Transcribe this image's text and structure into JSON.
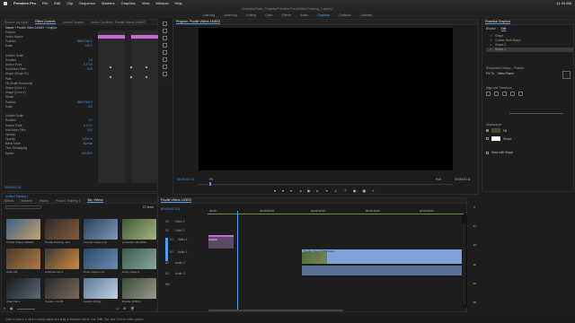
{
  "menubar": {
    "app": "Premiere Pro",
    "items": [
      "File",
      "Edit",
      "Clip",
      "Sequence",
      "Markers",
      "Graphics",
      "View",
      "Window",
      "Help"
    ],
    "clock": "11:34 AM"
  },
  "window_title": "/Volumes/Data/_Projects/Premiere Pro/Untitled Training_1.prproj *",
  "workspaces": {
    "items": [
      "Learning",
      "Assembly",
      "Editing",
      "Color",
      "Effects",
      "Audio",
      "Graphics",
      "Captions",
      "Libraries"
    ],
    "active_index": 6
  },
  "effect_controls": {
    "tabs": [
      "Source: (no clips)",
      "Effect Controls",
      "Lumetri Scopes",
      "Audio Clip Mixer: Poodle Videos 140823"
    ],
    "active_tab": 1,
    "header_clip": "Master * Poodle Video 140823 * Graphic",
    "rows": [
      {
        "label": "Graphic",
        "value": ""
      },
      {
        "label": "Vector Motion",
        "value": ""
      },
      {
        "label": "Position",
        "value": "960.0  540.0"
      },
      {
        "label": "Scale",
        "value": "100.0"
      },
      {
        "label": "",
        "value": ""
      },
      {
        "label": "Uniform Scale",
        "value": ""
      },
      {
        "label": "Rotation",
        "value": "0.0"
      },
      {
        "label": "Anchor Point",
        "value": "0.0  0.0"
      },
      {
        "label": "Anti-flicker Filter",
        "value": "0.00"
      },
      {
        "label": "Shape (Shape 01)",
        "value": ""
      },
      {
        "label": "Path",
        "value": ""
      },
      {
        "label": "Fill (Scale Horizontal)",
        "value": ""
      },
      {
        "label": "Shape (Color 1)",
        "value": ""
      },
      {
        "label": "Shape (Color 2)",
        "value": ""
      },
      {
        "label": "Stroke",
        "value": ""
      },
      {
        "label": "Position",
        "value": "960.0  540.0"
      },
      {
        "label": "Scale",
        "value": "100"
      },
      {
        "label": "",
        "value": ""
      },
      {
        "label": "Uniform Scale",
        "value": ""
      },
      {
        "label": "Rotation",
        "value": "0.0"
      },
      {
        "label": "Anchor Point",
        "value": "0.0  0.0"
      },
      {
        "label": "Anti-flicker Filter",
        "value": "0.00"
      },
      {
        "label": "Opacity",
        "value": ""
      },
      {
        "label": "Opacity",
        "value": "100.0 %"
      },
      {
        "label": "Blend Mode",
        "value": "Normal"
      },
      {
        "label": "Time Remapping",
        "value": ""
      },
      {
        "label": "Speed",
        "value": "100.00%"
      }
    ],
    "timecode": "00:00:02:13"
  },
  "program_monitor": {
    "title": "Program: Poodle Videos 140823",
    "timecode": "00:00:02:13",
    "fit": "Fit",
    "quality": "Full",
    "duration": "00:00:22:11"
  },
  "essential_graphics": {
    "title": "Essential Graphics",
    "tabs": [
      "Browse",
      "Edit"
    ],
    "active_tab": 1,
    "layers": [
      "Shape",
      "Custom Rect Shape",
      "Shape 2",
      "Shape 1"
    ],
    "responsive_label": "Responsive Design – Position",
    "pin_to": "Pin To:",
    "pin_target": "Video Frame",
    "align_label": "Align and Transform",
    "appearance_label": "Appearance",
    "fill_label": "Fill",
    "stroke_label": "Stroke",
    "shadow_label": "Mask with Shape",
    "fill_color": "#4a4a2e"
  },
  "project": {
    "title": "Untitled Training 1",
    "tabs": [
      "Effects",
      "Markers",
      "History",
      "Project: Training 1",
      "Bin: Videos"
    ],
    "active_tab": 4,
    "search_placeholder": "",
    "item_count": "12 Items",
    "items": [
      {
        "label": "Poodle Videos 140823"
      },
      {
        "label": "Poodle Dancing.mp4"
      },
      {
        "label": "ceramic shape.mp4"
      },
      {
        "label": "production 40-10Nm..."
      },
      {
        "label": "video still"
      },
      {
        "label": "celebrate clip 4"
      },
      {
        "label": "lovely shape.mp4"
      },
      {
        "label": "lovely shape 2"
      },
      {
        "label": "video frame"
      },
      {
        "label": "Poodle 1 40-55"
      },
      {
        "label": "Poodle still jpg"
      },
      {
        "label": "Poodle 40-55m"
      }
    ]
  },
  "timeline": {
    "title": "Poodle Videos 140823",
    "timecode": "00:00:02:13",
    "ruler": [
      "00:00",
      "00:00:05:00",
      "00:00:10:00",
      "00:00:15:00",
      "00:00:20:00"
    ],
    "tracks": [
      "V3",
      "V2",
      "V1",
      "A1",
      "A2",
      "A3",
      "Mix"
    ],
    "track_names": [
      "Video 3",
      "Video 2",
      "Video 1",
      "Audio 1",
      "Audio 2",
      "Audio 3"
    ],
    "graphic_clip": "Graphic",
    "video_clip": "Poodle Videos 140823.mp4",
    "meter_labels": [
      "0",
      "-12",
      "-24",
      "-36",
      "-48",
      "dB"
    ]
  },
  "status_bar": "Click to select, or click in empty space and drag to marquee select. Use Shift, Opt, and Cmd for other options.",
  "colors": {
    "accent": "#4a9df0",
    "clip_video": "#7fa3d6",
    "clip_graphic": "#c86ad3",
    "keyframe_lane": "#2a2a2a"
  }
}
